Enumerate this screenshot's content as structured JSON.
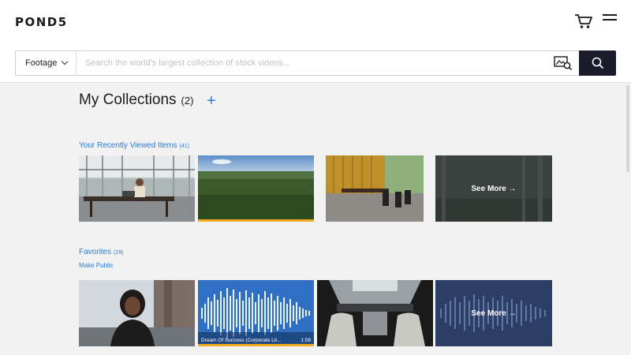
{
  "header": {
    "logo": "POND5",
    "cart_icon": "shopping-cart-icon",
    "menu_icon": "hamburger-menu-icon"
  },
  "search": {
    "type_label": "Footage",
    "placeholder": "Search the world's largest collection of stock videos...",
    "value": "",
    "visual_search_icon": "image-search-icon",
    "search_icon": "search-icon"
  },
  "page": {
    "title": "My Collections",
    "count": "(2)",
    "add_label": "+"
  },
  "recently_viewed": {
    "title": "Your Recently Viewed Items",
    "count": "(41)",
    "items": [
      {
        "name": "woman-working-in-modern-office",
        "progress": 0
      },
      {
        "name": "aerial-forest",
        "progress": 1.0
      },
      {
        "name": "modern-office-meeting-room",
        "progress": 0
      }
    ],
    "see_more": "See More →"
  },
  "favorites": {
    "title": "Favorites",
    "count": "(29)",
    "make_public": "Make Public",
    "items": [
      {
        "name": "smiling-woman-outdoors",
        "progress": 0
      },
      {
        "name": "audio-waveform",
        "caption": "Dream Of Success (Corporate Lit...",
        "duration": "1:58",
        "progress": 1.0
      },
      {
        "name": "car-interior-sunroof",
        "progress": 0
      }
    ],
    "see_more": "See More →"
  },
  "colors": {
    "accent_blue": "#2b7bdc",
    "search_button": "#1b1c2b",
    "progress_orange": "#f2a91a",
    "background": "#f2f2f2"
  }
}
